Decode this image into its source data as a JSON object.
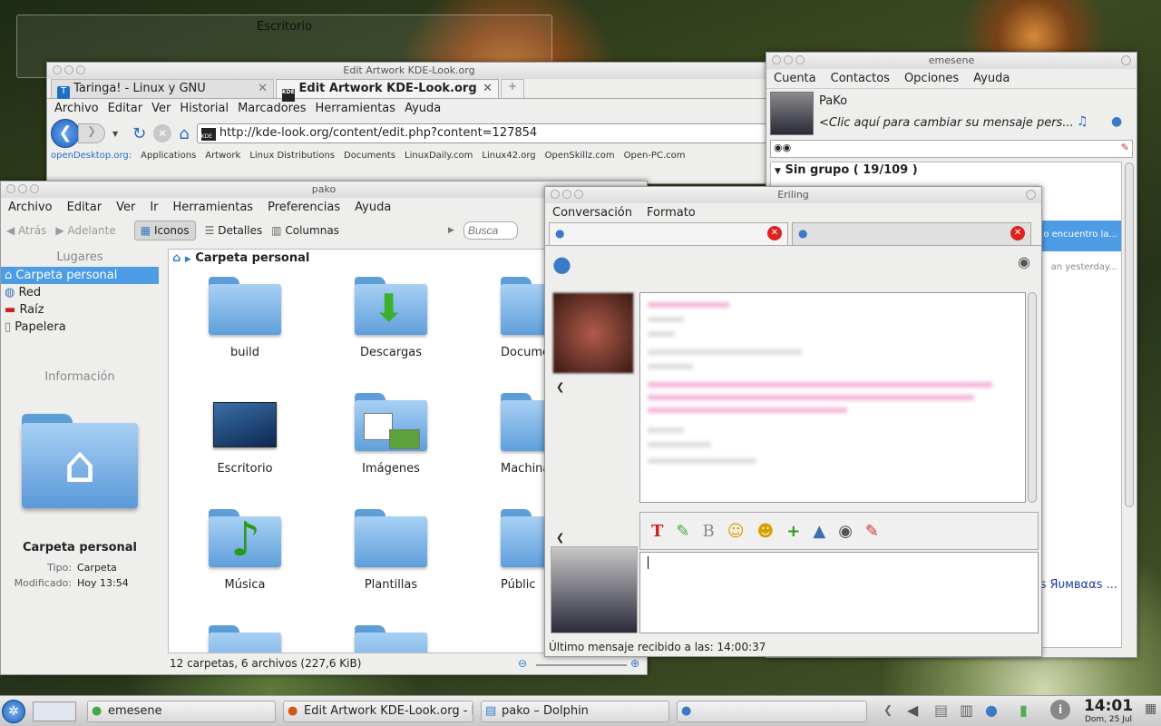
{
  "desktop": {
    "title": "Escritorio"
  },
  "firefox": {
    "window_title": "Edit Artwork KDE-Look.org",
    "tabs": [
      {
        "label": "Taringa! - Linux y GNU"
      },
      {
        "label": "Edit Artwork KDE-Look.org"
      }
    ],
    "menu": [
      "Archivo",
      "Editar",
      "Ver",
      "Historial",
      "Marcadores",
      "Herramientas",
      "Ayuda"
    ],
    "url": "http://kde-look.org/content/edit.php?content=127854",
    "bookmarks": [
      "openDesktop.org:",
      "Applications",
      "Artwork",
      "Linux Distributions",
      "Documents",
      "LinuxDaily.com",
      "Linux42.org",
      "OpenSkillz.com",
      "Open-PC.com"
    ]
  },
  "dolphin": {
    "window_title": "pako",
    "menu": [
      "Archivo",
      "Editar",
      "Ver",
      "Ir",
      "Herramientas",
      "Preferencias",
      "Ayuda"
    ],
    "toolbar": {
      "back": "Atrás",
      "forward": "Adelante",
      "icons": "Iconos",
      "details": "Detalles",
      "columns": "Columnas",
      "search_placeholder": "Busca"
    },
    "places_title": "Lugares",
    "places": [
      "Carpeta personal",
      "Red",
      "Raíz",
      "Papelera"
    ],
    "info_title": "Información",
    "info_name": "Carpeta personal",
    "info_type_label": "Tipo:",
    "info_type": "Carpeta",
    "info_modified_label": "Modificado:",
    "info_modified": "Hoy 13:54",
    "breadcrumb": "Carpeta personal",
    "items": [
      "build",
      "Descargas",
      "Docume",
      "Escritorio",
      "Imágenes",
      "Machina",
      "Música",
      "Plantillas",
      "Públic"
    ],
    "status": "12 carpetas, 6 archivos (227,6 KiB)"
  },
  "emesene": {
    "window_title": "emesene",
    "menu": [
      "Cuenta",
      "Contactos",
      "Opciones",
      "Ayuda"
    ],
    "nick": "PaKo",
    "message": "<Clic aquí para cambiar su mensaje pers...",
    "group": "Sin grupo ( 19/109 )",
    "contact_snippet": "o encuentro la...",
    "contact_snippet2": "an yesterday...",
    "contact_bottom": "s Яυмвααѕ ..."
  },
  "chat": {
    "window_title": "Eriling",
    "menu": [
      "Conversación",
      "Formato"
    ],
    "status": "Último mensaje recibido a las: 14:00:37"
  },
  "taskbar": {
    "tasks": [
      "emesene",
      "Edit Artwork KDE-Look.org - M",
      "pako – Dolphin"
    ],
    "time": "14:01",
    "date": "Dom, 25 Jul"
  }
}
